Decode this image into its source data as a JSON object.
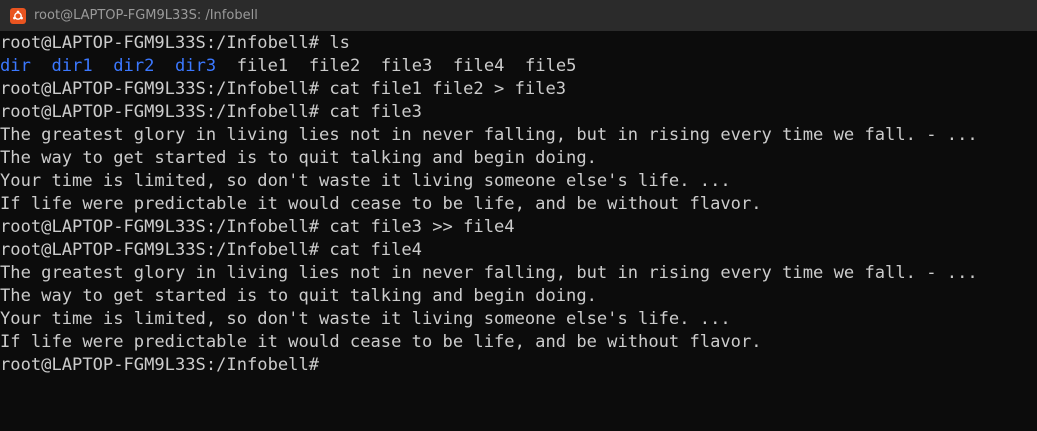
{
  "window": {
    "title": "root@LAPTOP-FGM9L33S: /Infobell",
    "icon": "ubuntu-icon",
    "icon_color": "#E95420"
  },
  "colors": {
    "background": "#0C0C0C",
    "foreground": "#CCCCCC",
    "directory": "#3B78FF",
    "titlebar": "#2B2B2B"
  },
  "terminal": {
    "prompt": "root@LAPTOP-FGM9L33S:/Infobell#",
    "ls_command": "ls",
    "ls_dirs": [
      "dir",
      "dir1",
      "dir2",
      "dir3"
    ],
    "ls_files": [
      "file1",
      "file2",
      "file3",
      "file4",
      "file5"
    ],
    "cmd_concat": "cat file1 file2 > file3",
    "cmd_cat_file3": "cat file3",
    "file3_output": [
      "The greatest glory in living lies not in never falling, but in rising every time we fall. - ...",
      "The way to get started is to quit talking and begin doing.",
      "Your time is limited, so don't waste it living someone else's life. ...",
      "If life were predictable it would cease to be life, and be without flavor."
    ],
    "cmd_append": "cat file3 >> file4",
    "cmd_cat_file4": "cat file4",
    "file4_output": [
      "The greatest glory in living lies not in never falling, but in rising every time we fall. - ...",
      "The way to get started is to quit talking and begin doing.",
      "Your time is limited, so don't waste it living someone else's life. ...",
      "If life were predictable it would cease to be life, and be without flavor."
    ]
  }
}
